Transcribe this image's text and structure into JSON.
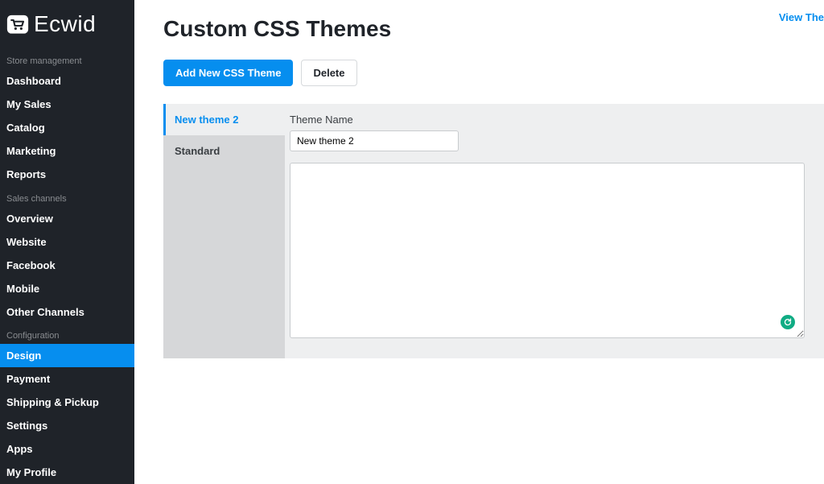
{
  "brand": {
    "name": "Ecwid"
  },
  "sidebar": {
    "section_store": "Store management",
    "section_sales": "Sales channels",
    "section_config": "Configuration",
    "store_items": [
      "Dashboard",
      "My Sales",
      "Catalog",
      "Marketing",
      "Reports"
    ],
    "sales_items": [
      "Overview",
      "Website",
      "Facebook",
      "Mobile",
      "Other Channels"
    ],
    "config_items": [
      "Design",
      "Payment",
      "Shipping & Pickup",
      "Settings",
      "Apps",
      "My Profile"
    ],
    "active": "Design"
  },
  "header": {
    "view_link": "View The"
  },
  "page": {
    "title": "Custom CSS Themes",
    "add_button": "Add New CSS Theme",
    "delete_button": "Delete"
  },
  "themes": {
    "items": [
      "New theme 2",
      "Standard"
    ],
    "active": "New theme 2"
  },
  "editor": {
    "name_label": "Theme Name",
    "name_value": "New theme 2",
    "css_value": ""
  },
  "colors": {
    "accent": "#068eef",
    "sidebar_bg": "#1f2329"
  }
}
